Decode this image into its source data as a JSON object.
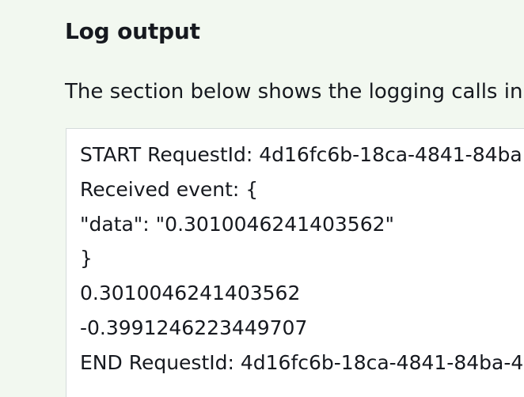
{
  "section": {
    "title": "Log output",
    "description": "The section below shows the logging calls in y"
  },
  "log": {
    "lines": [
      "START RequestId: 4d16fc6b-18ca-4841-84ba",
      "Received event: {",
      "\"data\": \"0.3010046241403562\"",
      "}",
      "0.3010046241403562",
      "-0.3991246223449707",
      "END RequestId: 4d16fc6b-18ca-4841-84ba-4"
    ]
  }
}
